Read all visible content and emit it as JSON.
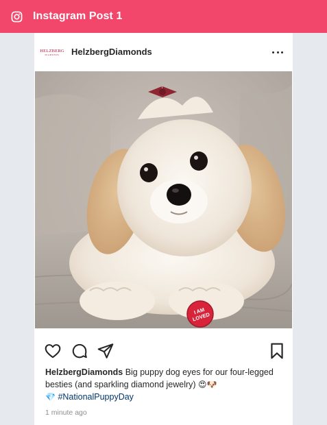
{
  "header": {
    "title": "Instagram Post 1",
    "icon": "instagram-icon",
    "background": "#f2476a"
  },
  "post": {
    "avatar_text": "HELZBERG",
    "avatar_subtext": "DIAMONDS",
    "username": "HelzbergDiamonds",
    "more_icon": "more-horizontal-icon",
    "image_alt": "Fluffy cream dog lying on a sofa with a red bow and an I AM LOVED button",
    "badge_line1": "I AM",
    "badge_line2": "LOVED",
    "actions": {
      "like_icon": "heart-icon",
      "comment_icon": "comment-icon",
      "share_icon": "paper-plane-icon",
      "save_icon": "bookmark-icon"
    },
    "caption": {
      "username": "HelzbergDiamonds",
      "text": " Big puppy dog eyes for our four-legged besties (and sparkling diamond jewelry) ",
      "emojis": "😍🐶",
      "diamond_emoji": "💎",
      "hashtag": "#NationalPuppyDay"
    },
    "timestamp": "1 minute ago"
  }
}
